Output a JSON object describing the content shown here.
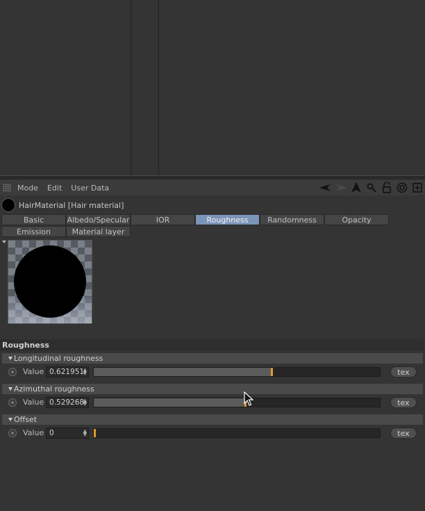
{
  "menubar": {
    "items": [
      "Mode",
      "Edit",
      "User Data"
    ],
    "icons": [
      "back-arrow-icon",
      "forward-arrow-icon",
      "up-arrow-icon",
      "search-icon",
      "lock-icon",
      "target-icon",
      "new-panel-icon"
    ]
  },
  "material": {
    "title": "HairMaterial [Hair material]"
  },
  "tabs": [
    {
      "label": "Basic",
      "active": false
    },
    {
      "label": "Albedo/Specular",
      "active": false
    },
    {
      "label": "IOR",
      "active": false
    },
    {
      "label": "Roughness",
      "active": true
    },
    {
      "label": "Randomness",
      "active": false
    },
    {
      "label": "Opacity",
      "active": false
    },
    {
      "label": "Emission",
      "active": false
    },
    {
      "label": "Material layer",
      "active": false
    }
  ],
  "section": {
    "title": "Roughness"
  },
  "groups": [
    {
      "title": "Longitudinal roughness",
      "label": "Value",
      "value": "0.621951",
      "fraction": 0.621951,
      "tex_label": "tex"
    },
    {
      "title": "Azimuthal roughness",
      "label": "Value",
      "value": "0.529268",
      "fraction": 0.529268,
      "tex_label": "tex"
    },
    {
      "title": "Offset",
      "label": "Value",
      "value": "0",
      "fraction": 0,
      "tex_label": "tex"
    }
  ],
  "colors": {
    "active_tab": "#7b94b8",
    "slider_marker": "#e09a2a",
    "panel_bg": "#343434"
  }
}
